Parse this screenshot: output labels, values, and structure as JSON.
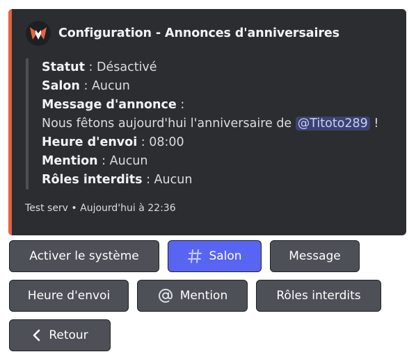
{
  "embed": {
    "author": "Configuration - Annonces d'anniversaires",
    "fields": [
      {
        "label": "Statut",
        "sep": " : ",
        "value": "Désactivé"
      },
      {
        "label": "Salon",
        "sep": " : ",
        "value": "Aucun"
      },
      {
        "label": "Message d'annonce",
        "sep": " :",
        "value": ""
      },
      {
        "label": "Heure d'envoi",
        "sep": " : ",
        "value": "08:00"
      },
      {
        "label": "Mention",
        "sep": " : ",
        "value": "Aucun"
      },
      {
        "label": "Rôles interdits",
        "sep": " : ",
        "value": "Aucun"
      }
    ],
    "message_text": "Nous fêtons aujourd'hui l'anniversaire de ",
    "message_mention": "@Titoto289",
    "message_end": " !",
    "footer": "Test serv • Aujourd'hui à 22:36",
    "accent_color": "#e4643f"
  },
  "buttons": {
    "activate": "Activer le système",
    "salon": "Salon",
    "message": "Message",
    "heure": "Heure d'envoi",
    "mention": "Mention",
    "roles": "Rôles interdits",
    "retour": "Retour"
  },
  "icons": {
    "author": "bot-avatar-icon",
    "salon": "hashtag-icon",
    "mention": "at-icon",
    "retour": "chevron-left-icon"
  },
  "colors": {
    "primary": "#5865f2",
    "secondary": "#4e5058",
    "embed_bg": "#2b2d31"
  }
}
